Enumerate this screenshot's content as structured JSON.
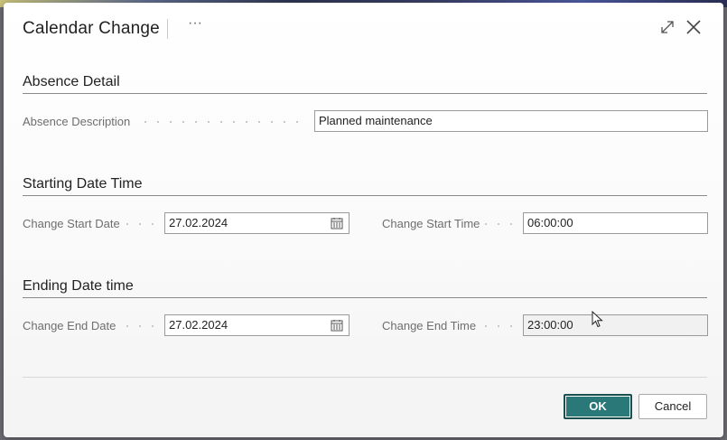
{
  "dialog": {
    "title": "Calendar Change",
    "more_icon_label": "···"
  },
  "sections": {
    "absence": {
      "title": "Absence Detail",
      "description_label": "Absence Description",
      "description_value": "Planned maintenance"
    },
    "starting": {
      "title": "Starting Date Time",
      "start_date_label": "Change Start Date",
      "start_date_value": "27.02.2024",
      "start_time_label": "Change Start Time",
      "start_time_value": "06:00:00"
    },
    "ending": {
      "title": "Ending Date time",
      "end_date_label": "Change End Date",
      "end_date_value": "27.02.2024",
      "end_time_label": "Change End Time",
      "end_time_value": "23:00:00"
    }
  },
  "footer": {
    "ok_label": "OK",
    "cancel_label": "Cancel"
  },
  "colors": {
    "accent": "#2a7878",
    "accent_border": "#1a4f4f"
  },
  "icons": [
    "more-options-icon",
    "expand-icon",
    "close-icon",
    "calendar-icon",
    "mouse-cursor-icon"
  ]
}
